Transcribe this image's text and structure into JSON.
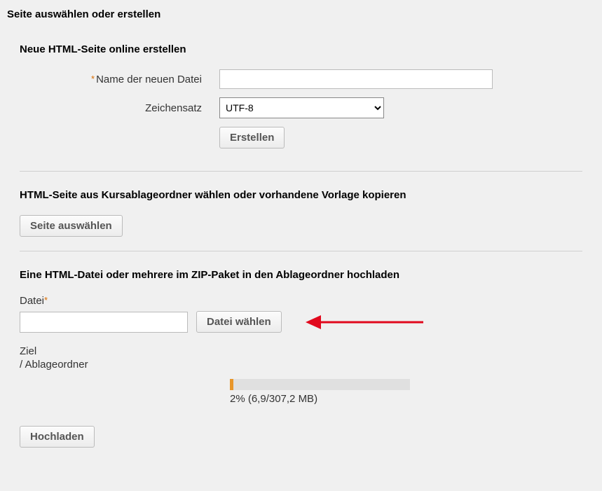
{
  "page": {
    "title": "Seite auswählen oder erstellen"
  },
  "createSection": {
    "title": "Neue HTML-Seite online erstellen",
    "filenameLabel": "Name der neuen Datei",
    "charsetLabel": "Zeichensatz",
    "charsetValue": "UTF-8",
    "createButton": "Erstellen"
  },
  "chooseSection": {
    "title": "HTML-Seite aus Kursablageordner wählen oder vorhandene Vorlage kopieren",
    "chooseButton": "Seite auswählen"
  },
  "uploadSection": {
    "title": "Eine HTML-Datei oder mehrere im ZIP-Paket in den Ablageordner hochladen",
    "fileLabel": "Datei",
    "fileChooseButton": "Datei wählen",
    "targetLabel": "Ziel",
    "targetValue": "/ Ablageordner",
    "progressPercent": 2,
    "progressText": "2% (6,9/307,2 MB)",
    "uploadButton": "Hochladen"
  }
}
